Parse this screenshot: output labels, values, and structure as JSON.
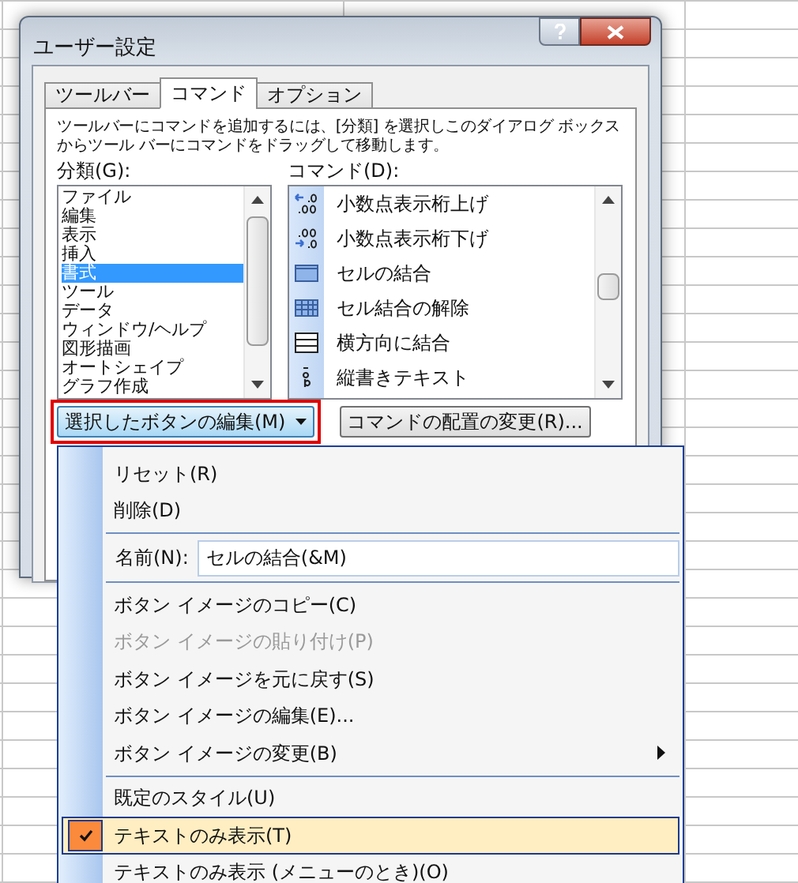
{
  "window": {
    "title": "ユーザー設定"
  },
  "tabs": [
    {
      "label": "ツールバー",
      "selected": false
    },
    {
      "label": "コマンド",
      "selected": true
    },
    {
      "label": "オプション",
      "selected": false
    }
  ],
  "instructions": "ツールバーにコマンドを追加するには、[分類] を選択しこのダイアログ ボックスからツール バーにコマンドをドラッグして移動します。",
  "categories": {
    "label": "分類(G):",
    "items": [
      {
        "label": "ファイル",
        "selected": false
      },
      {
        "label": "編集",
        "selected": false
      },
      {
        "label": "表示",
        "selected": false
      },
      {
        "label": "挿入",
        "selected": false
      },
      {
        "label": "書式",
        "selected": true
      },
      {
        "label": "ツール",
        "selected": false
      },
      {
        "label": "データ",
        "selected": false
      },
      {
        "label": "ウィンドウ/ヘルプ",
        "selected": false
      },
      {
        "label": "図形描画",
        "selected": false
      },
      {
        "label": "オートシェイプ",
        "selected": false
      },
      {
        "label": "グラフ作成",
        "selected": false
      }
    ]
  },
  "commands": {
    "label": "コマンド(D):",
    "items": [
      {
        "label": "小数点表示桁上げ"
      },
      {
        "label": "小数点表示桁下げ"
      },
      {
        "label": "セルの結合"
      },
      {
        "label": "セル結合の解除"
      },
      {
        "label": "横方向に結合"
      },
      {
        "label": "縦書きテキスト"
      }
    ]
  },
  "buttons": [
    {
      "label": "選択したボタンの編集(M)",
      "kind": "dropdown",
      "outlined": true
    },
    {
      "label": "コマンドの配置の変更(R)...",
      "kind": "plain"
    }
  ],
  "menu": {
    "items": [
      {
        "kind": "item",
        "label": "リセット(R)",
        "disabled": false,
        "checked": false,
        "selected": false
      },
      {
        "kind": "item",
        "label": "削除(D)",
        "disabled": false,
        "checked": false,
        "selected": false
      },
      {
        "kind": "separator"
      },
      {
        "kind": "field",
        "label": "名前(N):",
        "value": "セルの結合(&M)"
      },
      {
        "kind": "separator"
      },
      {
        "kind": "item",
        "label": "ボタン イメージのコピー(C)",
        "disabled": false,
        "checked": false,
        "selected": false
      },
      {
        "kind": "item",
        "label": "ボタン イメージの貼り付け(P)",
        "disabled": true,
        "checked": false,
        "selected": false
      },
      {
        "kind": "item",
        "label": "ボタン イメージを元に戻す(S)",
        "disabled": false,
        "checked": false,
        "selected": false
      },
      {
        "kind": "item",
        "label": "ボタン イメージの編集(E)...",
        "disabled": false,
        "checked": false,
        "selected": false
      },
      {
        "kind": "submenu",
        "label": "ボタン イメージの変更(B)",
        "disabled": false,
        "checked": false,
        "selected": false
      },
      {
        "kind": "separator"
      },
      {
        "kind": "item",
        "label": "既定のスタイル(U)",
        "disabled": false,
        "checked": false,
        "selected": false
      },
      {
        "kind": "item",
        "label": "テキストのみ表示(T)",
        "disabled": false,
        "checked": true,
        "selected": true
      },
      {
        "kind": "item",
        "label": "テキストのみ表示 (メニューのとき)(O)",
        "disabled": false,
        "checked": false,
        "selected": false
      }
    ]
  }
}
